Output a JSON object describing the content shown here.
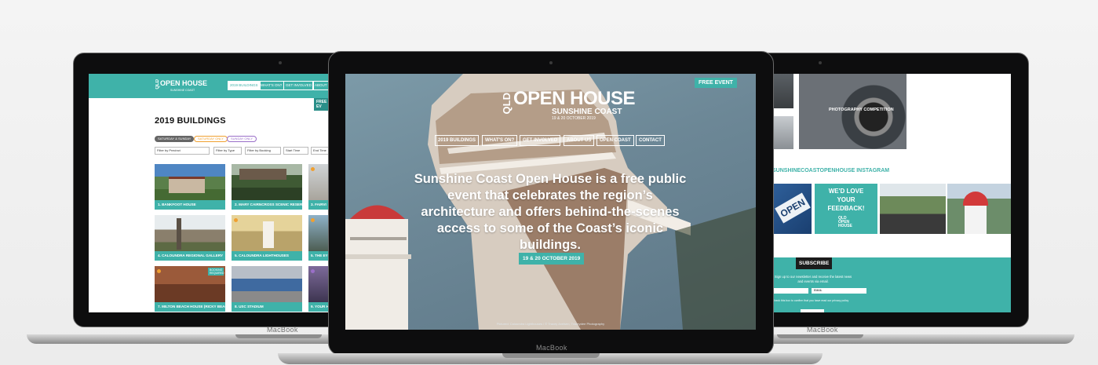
{
  "device": {
    "brand_label": "MacBook"
  },
  "colors": {
    "accent": "#3fb2a9",
    "accent_dark": "#2a8f89",
    "ink": "#111111"
  },
  "left_screen": {
    "logo": {
      "prefix": "QLD",
      "name": "OPEN HOUSE",
      "region": "SUNSHINE COAST"
    },
    "nav": [
      "2019 BUILDINGS",
      "WHAT'S ON?",
      "GET INVOLVED",
      "ABOUT US"
    ],
    "free_event": "FREE EV",
    "title": "2019 BUILDINGS",
    "day_filters": [
      "SATURDAY & SUNDAY",
      "SATURDAY ONLY",
      "SUNDAY ONLY"
    ],
    "filters": [
      "Filter by Precinct",
      "Filter by Type",
      "Filter by Booking",
      "Start Time",
      "End Time"
    ],
    "cards": [
      {
        "label": "1. BANKFOOT HOUSE"
      },
      {
        "label": "2. MARY CAIRNCROSS SCENIC RESERVE ..."
      },
      {
        "label": "3. FAIRVI"
      },
      {
        "label": "4. CALOUNDRA REGIONAL GALLERY"
      },
      {
        "label": "5. CALOUNDRA LIGHTHOUSES"
      },
      {
        "label": "5. THE EYE"
      },
      {
        "label": "7. MILTON BEACH HOUSE (RICKY BEACH ..."
      },
      {
        "label": "8. USC STADIUM"
      },
      {
        "label": "9. YOUR H"
      }
    ],
    "booking_badge": "BOOKING REQUIRED"
  },
  "center_screen": {
    "free_event": "FREE EVENT",
    "logo": {
      "prefix": "QLD",
      "name": "OPEN HOUSE",
      "region": "SUNSHINE COAST",
      "date": "19 & 20 OCTOBER 2019"
    },
    "nav": [
      "2019 BUILDINGS",
      "WHAT'S ON?",
      "GET INVOLVED",
      "ABOUT US",
      "OPEN COAST",
      "CONTACT"
    ],
    "headline": "Sunshine Coast Open House is a free public event that celebrates the region’s architecture and offers behind-the-scenes access to some of the Coast’s iconic buildings.",
    "date_button": "19 & 20 OCTOBER 2019",
    "credit": "Pictured: Caloundra Lighthouses / © Tracey Axelsen, Traceydee Photography"
  },
  "right_screen": {
    "photo_competition": "PHOTOGRAPHY COMPETITION",
    "instagram_title": "SUNSHINECOASTOPENHOUSE INSTAGRAM",
    "feedback": [
      "WE'D LOVE",
      "YOUR",
      "FEEDBACK!"
    ],
    "feedback_logo": [
      "QLD",
      "OPEN",
      "HOUSE"
    ],
    "sign_text": "OPEN",
    "subscribe_label": "SUBSCRIBE",
    "subscribe_text": "Sign up to our newsletter and receive the latest news and events via email.",
    "email_placeholder": "EMAIL",
    "privacy_text": "Check this box to confirm that you have read our privacy policy"
  }
}
